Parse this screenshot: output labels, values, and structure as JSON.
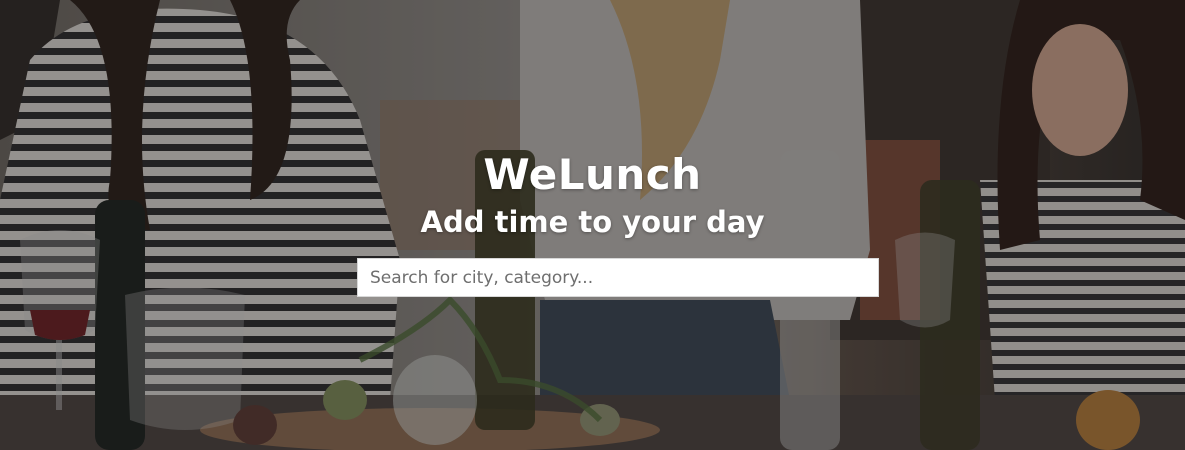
{
  "hero": {
    "brand": "WeLunch",
    "tagline": "Add time to your day",
    "background_image": "friends-sharing-lunch-photo"
  },
  "search": {
    "placeholder": "Search for city, category...",
    "value": ""
  },
  "colors": {
    "text": "#ffffff",
    "input_background": "#ffffff",
    "placeholder": "#6e6e6e",
    "overlay": "#141210"
  }
}
